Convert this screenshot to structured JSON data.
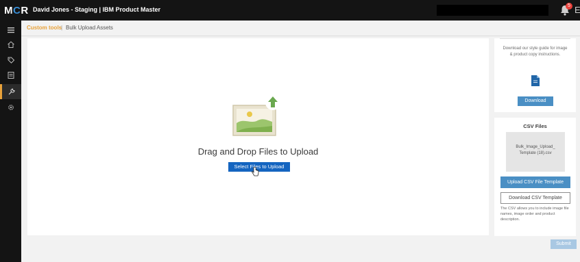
{
  "header": {
    "logo": "MCR",
    "org_title": "David Jones - Staging | IBM Product Master",
    "notifications_count": "5",
    "user_initial": "E"
  },
  "sidebar": {
    "items": [
      {
        "icon": "menu-icon"
      },
      {
        "icon": "home-icon"
      },
      {
        "icon": "tag-icon"
      },
      {
        "icon": "catalog-icon"
      },
      {
        "icon": "tools-icon",
        "active": true
      },
      {
        "icon": "settings-icon"
      }
    ],
    "active_color": "#e8a23a"
  },
  "breadcrumb": {
    "parent": "Custom tools",
    "separator": "|",
    "current": "Bulk Upload Assets"
  },
  "dropzone": {
    "title": "Drag and Drop Files to Upload",
    "select_button": "Select Files to Upload"
  },
  "style_guide": {
    "text": "Download our style guide for image & product copy instructions.",
    "download_button": "Download"
  },
  "csv": {
    "title": "CSV Files",
    "file_name": "Bulk_Image_Upload_ Template (18).csv",
    "upload_button": "Upload CSV File Template",
    "download_button": "Download CSV Template",
    "description": "The CSV allows you to include image file names, image order and product description."
  },
  "submit_button": "Submit",
  "colors": {
    "accent": "#e8a23a",
    "primary_button": "#1565c0",
    "secondary_button": "#4a8fc4"
  }
}
